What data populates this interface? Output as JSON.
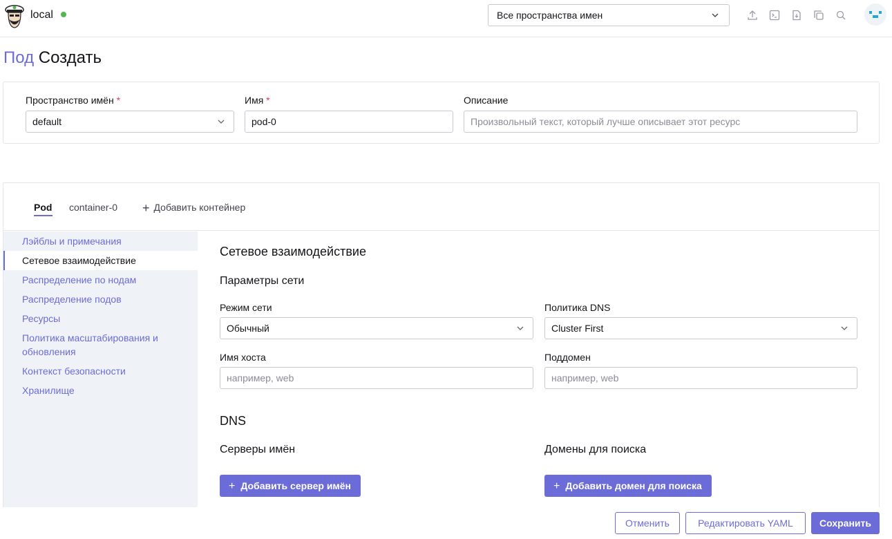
{
  "header": {
    "cluster_name": "local",
    "namespace_select": "Все пространства имен",
    "icons": [
      "upload-icon",
      "terminal-icon",
      "download-file-icon",
      "copy-icon",
      "search-icon"
    ]
  },
  "page_title": {
    "type": "Под",
    "action": "Создать"
  },
  "top_form": {
    "namespace_label": "Пространство имён",
    "namespace_value": "default",
    "name_label": "Имя",
    "name_value": "pod-0",
    "description_label": "Описание",
    "description_placeholder": "Произвольный текст, который лучше описывает этот ресурс",
    "required_mark": "*"
  },
  "tabs": {
    "pod": "Pod",
    "container": "container-0",
    "add_container": "Добавить контейнер"
  },
  "side_nav": {
    "items": [
      "Лэйблы и примечания",
      "Сетевое взаимодействие",
      "Распределение по нодам",
      "Распределение подов",
      "Ресурсы",
      "Политика масштабирования и обновления",
      "Контекст безопасности",
      "Хранилище"
    ],
    "active_index": 1
  },
  "networking": {
    "title": "Сетевое взаимодействие",
    "network_params": "Параметры сети",
    "network_mode_label": "Режим сети",
    "network_mode_value": "Обычный",
    "dns_policy_label": "Политика DNS",
    "dns_policy_value": "Cluster First",
    "hostname_label": "Имя хоста",
    "hostname_placeholder": "например, web",
    "subdomain_label": "Поддомен",
    "subdomain_placeholder": "например, web",
    "dns_title": "DNS",
    "nameservers_label": "Серверы имён",
    "add_nameserver": "Добавить сервер имён",
    "search_domains_label": "Домены для поиска",
    "add_search_domain": "Добавить домен для поиска"
  },
  "footer": {
    "cancel": "Отменить",
    "edit_yaml": "Редактировать YAML",
    "save": "Сохранить"
  },
  "colors": {
    "accent": "#6c6cd8",
    "status_ok": "#4fb84e",
    "required": "#e5395a",
    "sidebar_bg": "#eff2f7"
  }
}
